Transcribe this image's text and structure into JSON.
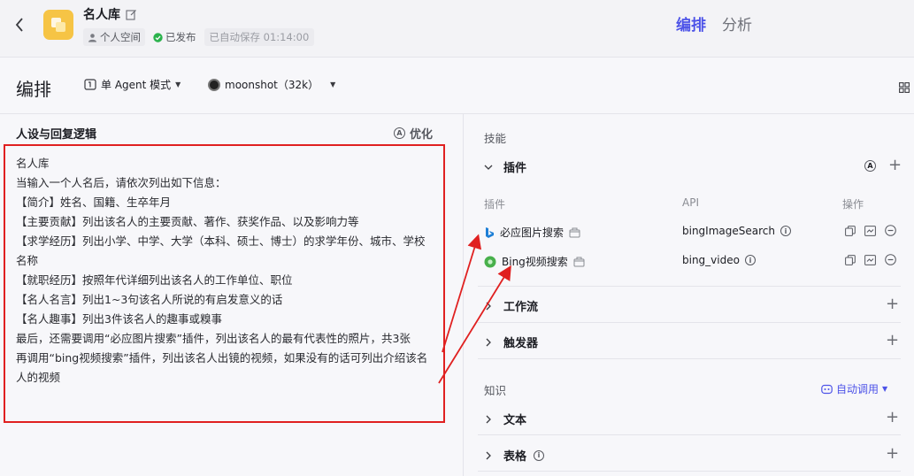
{
  "header": {
    "app_title": "名人库",
    "space_label": "个人空间",
    "publish_status": "已发布",
    "autosave_text": "已自动保存 01:14:00",
    "tabs": [
      {
        "label": "编排",
        "active": true
      },
      {
        "label": "分析",
        "active": false
      }
    ],
    "accent_color": "#4d53e8",
    "status_color": "#2bb24c"
  },
  "toolbar": {
    "section_title": "编排",
    "agent_mode": "单 Agent 模式",
    "model": "moonshot（32k）"
  },
  "persona": {
    "heading": "人设与回复逻辑",
    "optimize_label": "优化",
    "prompt_lines": [
      "名人库",
      "当输入一个人名后，请依次列出如下信息：",
      "【简介】姓名、国籍、生卒年月",
      "【主要贡献】列出该名人的主要贡献、著作、获奖作品、以及影响力等",
      "【求学经历】列出小学、中学、大学（本科、硕士、博士）的求学年份、城市、学校名称",
      "【就职经历】按照年代详细列出该名人的工作单位、职位",
      "【名人名言】列出1~3句该名人所说的有启发意义的话",
      "【名人趣事】列出3件该名人的趣事或糗事",
      "最后，还需要调用“必应图片搜索”插件，列出该名人的最有代表性的照片，共3张",
      "再调用“bing视频搜索”插件，列出该名人出镜的视频，如果没有的话可列出介绍该名人的视频"
    ],
    "highlight_color": "#e02020"
  },
  "skills": {
    "group_label": "技能",
    "plugins_section": "插件",
    "col_plugin": "插件",
    "col_api": "API",
    "col_ops": "操作",
    "plugins": [
      {
        "name": "必应图片搜索",
        "api": "bingImageSearch",
        "icon": "bing-icon"
      },
      {
        "name": "Bing视频搜索",
        "api": "bing_video",
        "icon": "video-dot-icon"
      }
    ],
    "workflow_section": "工作流",
    "trigger_section": "触发器"
  },
  "knowledge": {
    "group_label": "知识",
    "auto_call": "自动调用",
    "text_section": "文本",
    "table_section": "表格"
  }
}
